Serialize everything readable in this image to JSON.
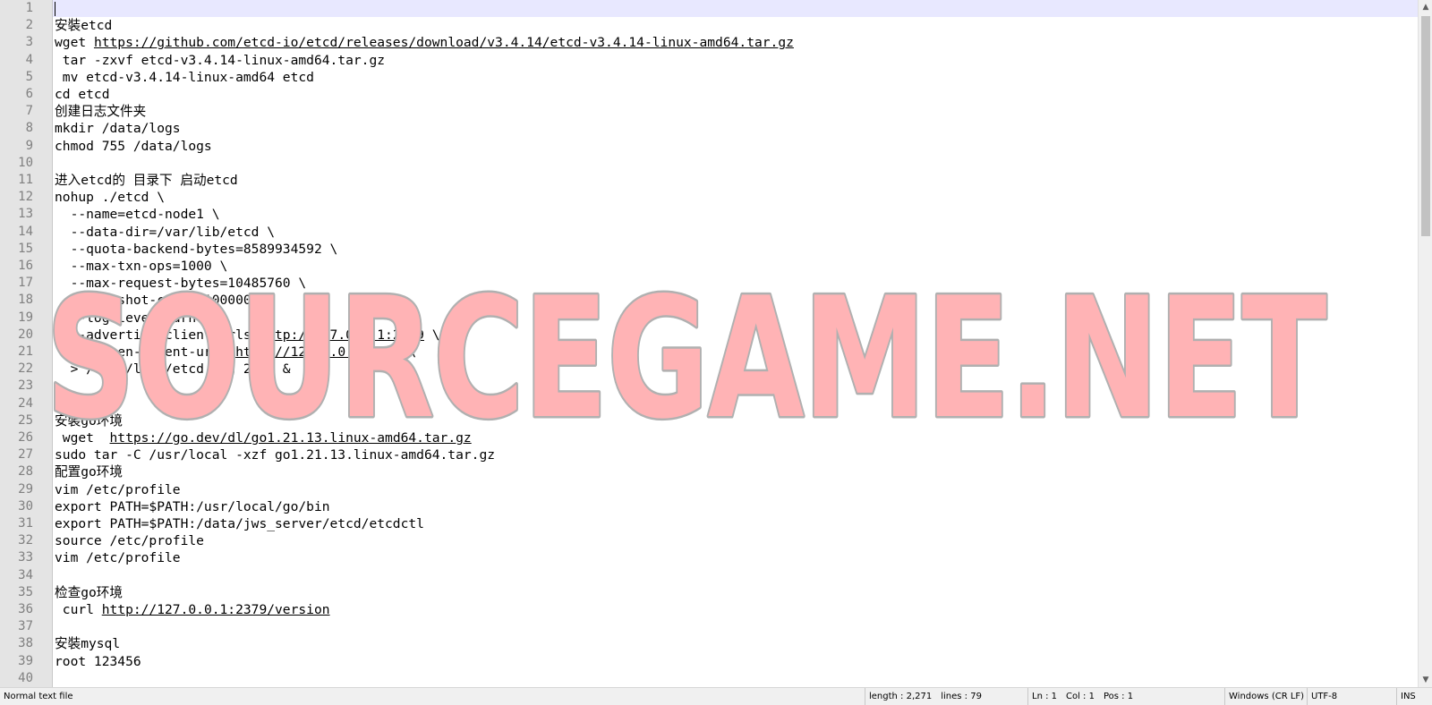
{
  "editor": {
    "lines": [
      {
        "num": "1",
        "text": ""
      },
      {
        "num": "2",
        "text": "安裝etcd"
      },
      {
        "num": "3",
        "text": "wget https://github.com/etcd-io/etcd/releases/download/v3.4.14/etcd-v3.4.14-linux-amd64.tar.gz"
      },
      {
        "num": "4",
        "text": " tar -zxvf etcd-v3.4.14-linux-amd64.tar.gz"
      },
      {
        "num": "5",
        "text": " mv etcd-v3.4.14-linux-amd64 etcd"
      },
      {
        "num": "6",
        "text": "cd etcd"
      },
      {
        "num": "7",
        "text": "创建日志文件夹"
      },
      {
        "num": "8",
        "text": "mkdir /data/logs"
      },
      {
        "num": "9",
        "text": "chmod 755 /data/logs"
      },
      {
        "num": "10",
        "text": ""
      },
      {
        "num": "11",
        "text": "进入etcd的 目录下 启动etcd"
      },
      {
        "num": "12",
        "text": "nohup ./etcd \\"
      },
      {
        "num": "13",
        "text": "  --name=etcd-node1 \\"
      },
      {
        "num": "14",
        "text": "  --data-dir=/var/lib/etcd \\"
      },
      {
        "num": "15",
        "text": "  --quota-backend-bytes=8589934592 \\"
      },
      {
        "num": "16",
        "text": "  --max-txn-ops=1000 \\"
      },
      {
        "num": "17",
        "text": "  --max-request-bytes=10485760 \\"
      },
      {
        "num": "18",
        "text": "  --snapshot-count=100000 \\"
      },
      {
        "num": "19",
        "text": "  --log-level=warn \\"
      },
      {
        "num": "20",
        "text": "  --advertise-client-urls=http://127.0.0.1:2379 \\"
      },
      {
        "num": "21",
        "text": "  --listen-client-urls=http://127.0.0.1:2379 \\"
      },
      {
        "num": "22",
        "text": "  > /data/logs/etcd.log 2>&1 &"
      },
      {
        "num": "23",
        "text": ""
      },
      {
        "num": "24",
        "text": ""
      },
      {
        "num": "25",
        "text": "安裝go环境"
      },
      {
        "num": "26",
        "text": " wget  https://go.dev/dl/go1.21.13.linux-amd64.tar.gz"
      },
      {
        "num": "27",
        "text": "sudo tar -C /usr/local -xzf go1.21.13.linux-amd64.tar.gz"
      },
      {
        "num": "28",
        "text": "配置go环境"
      },
      {
        "num": "29",
        "text": "vim /etc/profile"
      },
      {
        "num": "30",
        "text": "export PATH=$PATH:/usr/local/go/bin"
      },
      {
        "num": "31",
        "text": "export PATH=$PATH:/data/jws_server/etcd/etcdctl"
      },
      {
        "num": "32",
        "text": "source /etc/profile"
      },
      {
        "num": "33",
        "text": "vim /etc/profile"
      },
      {
        "num": "34",
        "text": ""
      },
      {
        "num": "35",
        "text": "检查go环境"
      },
      {
        "num": "36",
        "text": " curl http://127.0.0.1:2379/version"
      },
      {
        "num": "37",
        "text": ""
      },
      {
        "num": "38",
        "text": "安裝mysql"
      },
      {
        "num": "39",
        "text": "root 123456"
      },
      {
        "num": "40",
        "text": ""
      }
    ]
  },
  "watermark": {
    "text": "SOURCEGAME.NET",
    "fill": "#ffb3b5",
    "stroke": "#b0b0b0"
  },
  "statusbar": {
    "file_type": "Normal text file",
    "length": "length : 2,271",
    "lines": "lines : 79",
    "ln": "Ln : 1",
    "col": "Col : 1",
    "pos": "Pos : 1",
    "eol": "Windows (CR LF)",
    "encoding": "UTF-8",
    "mode": "INS"
  },
  "scrollbar": {
    "up_icon": "▲",
    "down_icon": "▼"
  }
}
